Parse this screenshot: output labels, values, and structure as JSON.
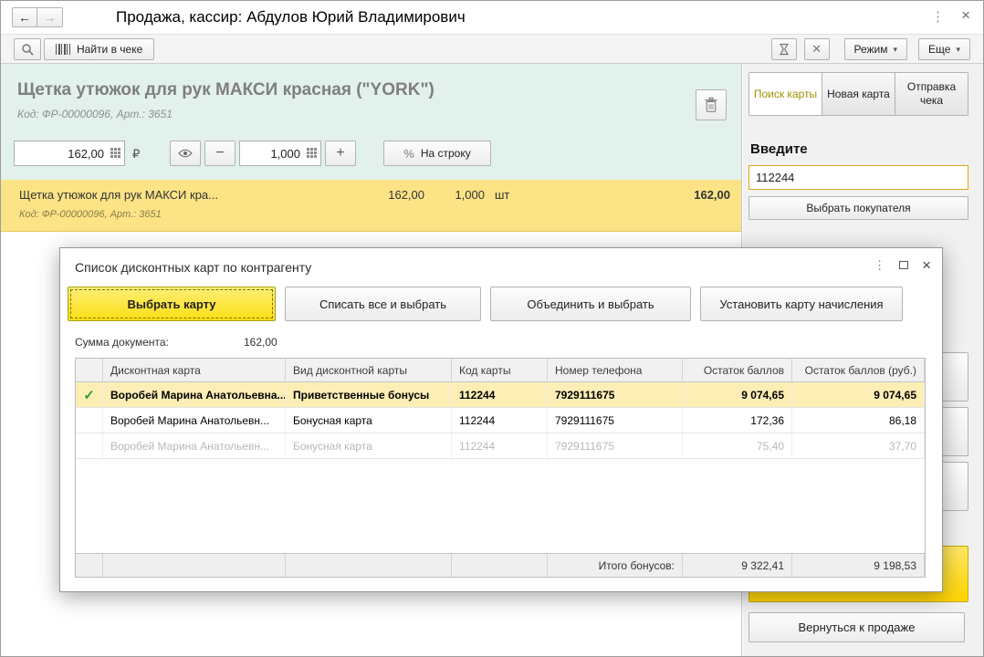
{
  "window": {
    "title": "Продажа, кассир: Абдулов Юрий Владимирович"
  },
  "toolbar": {
    "find_in_receipt": "Найти в чеке",
    "mode": "Режим",
    "more": "Еще"
  },
  "product": {
    "title": "Щетка утюжок для рук МАКСИ красная (\"YORK\")",
    "code_line": "Код: ФР-00000096, Арт.: 3651",
    "price": "162,00",
    "currency": "₽",
    "quantity": "1,000",
    "percent": "%",
    "per_line_label": "На строку"
  },
  "receipt": {
    "name": "Щетка утюжок для рук МАКСИ кра...",
    "price": "162,00",
    "quantity": "1,000",
    "unit": "шт",
    "total": "162,00",
    "code_line": "Код: ФР-00000096, Арт.: 3651"
  },
  "sidebar": {
    "tabs": [
      {
        "label": "Поиск карты"
      },
      {
        "label": "Новая карта"
      },
      {
        "label": "Отправка чека"
      }
    ],
    "enter_label": "Введите",
    "card_number": "112244",
    "select_customer": "Выбрать покупателя",
    "return_to_sale": "Вернуться к продаже"
  },
  "modal": {
    "title": "Список дисконтных карт по контрагенту",
    "buttons": [
      {
        "label": "Выбрать карту"
      },
      {
        "label": "Списать все и выбрать"
      },
      {
        "label": "Объединить и выбрать"
      },
      {
        "label": "Установить карту начисления"
      }
    ],
    "sum_label": "Сумма документа:",
    "sum_value": "162,00",
    "table": {
      "headers": [
        "Дисконтная карта",
        "Вид дисконтной карты",
        "Код карты",
        "Номер телефона",
        "Остаток баллов",
        "Остаток баллов (руб.)"
      ],
      "rows": [
        {
          "card": "Воробей Марина Анатольевна...",
          "type": "Приветственные бонусы",
          "code": "112244",
          "phone": "7929111675",
          "points": "9 074,65",
          "rub": "9 074,65"
        },
        {
          "card": "Воробей Марина Анатольевн...",
          "type": "Бонусная карта",
          "code": "112244",
          "phone": "7929111675",
          "points": "172,36",
          "rub": "86,18"
        },
        {
          "card": "Воробей Марина Анатольевн...",
          "type": "Бонусная карта",
          "code": "112244",
          "phone": "7929111675",
          "points": "75,40",
          "rub": "37,70"
        }
      ],
      "footer_label": "Итого бонусов:",
      "footer_points": "9 322,41",
      "footer_rub": "9 198,53"
    }
  },
  "colors": {
    "accent_yellow": "#ffdf0d",
    "selected_row": "#fdeeb6",
    "panel_teal": "#e2f1eb",
    "input_highlight": "#dca910"
  }
}
